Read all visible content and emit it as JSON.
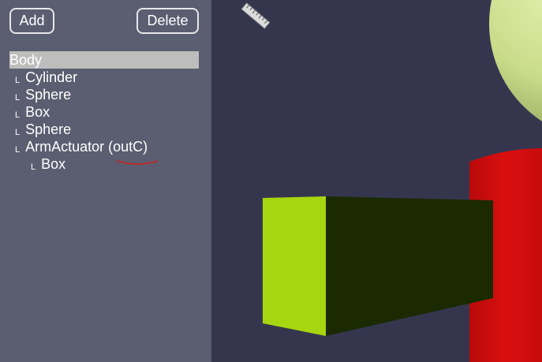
{
  "toolbar": {
    "add_label": "Add",
    "delete_label": "Delete"
  },
  "tree": {
    "root": "Body",
    "children": [
      {
        "label": "Cylinder"
      },
      {
        "label": "Sphere"
      },
      {
        "label": "Box"
      },
      {
        "label": "Sphere"
      },
      {
        "label": "ArmActuator (outC)"
      }
    ],
    "grandchildren": [
      {
        "label": "Box"
      }
    ],
    "branch_glyph": "L"
  },
  "viewport": {
    "background": "#35364e",
    "objects": [
      {
        "name": "box",
        "front_color": "#a6d60f",
        "side_color": "#1b2a00"
      },
      {
        "name": "cylinder",
        "color": "#d50f0f"
      },
      {
        "name": "sphere",
        "color": "#c9dc8a"
      },
      {
        "name": "ruler-icon"
      }
    ]
  },
  "annotation": {
    "underline_color": "#cc2020"
  }
}
